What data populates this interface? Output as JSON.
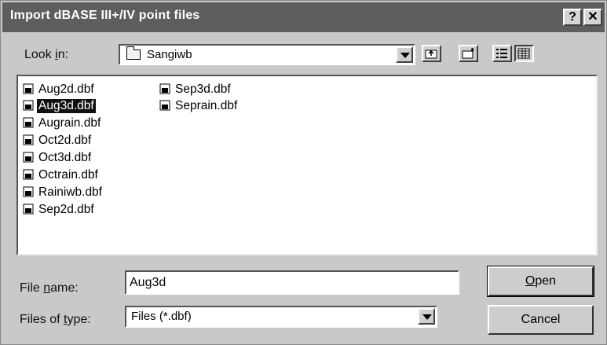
{
  "dialog": {
    "title": "Import dBASE III+/IV point files",
    "title_buttons": {
      "help": "?",
      "close": "✕"
    }
  },
  "look_in": {
    "label_prefix": "Look ",
    "label_mnemonic": "i",
    "label_suffix": "n:",
    "value": "Sangiwb",
    "folder_icon": "folder-icon"
  },
  "toolbar": {
    "up_icon": "up-one-level-icon",
    "new_folder_icon": "new-folder-icon",
    "list_icon": "list-view-icon",
    "details_icon": "details-view-icon"
  },
  "files": {
    "column1": [
      {
        "name": "Aug2d.dbf",
        "selected": false
      },
      {
        "name": "Aug3d.dbf",
        "selected": true
      },
      {
        "name": "Augrain.dbf",
        "selected": false
      },
      {
        "name": "Oct2d.dbf",
        "selected": false
      },
      {
        "name": "Oct3d.dbf",
        "selected": false
      },
      {
        "name": "Octrain.dbf",
        "selected": false
      },
      {
        "name": "Rainiwb.dbf",
        "selected": false
      },
      {
        "name": "Sep2d.dbf",
        "selected": false
      }
    ],
    "column2": [
      {
        "name": "Sep3d.dbf",
        "selected": false
      },
      {
        "name": "Seprain.dbf",
        "selected": false
      }
    ],
    "file_icon": "dbf-file-icon"
  },
  "file_name": {
    "label_prefix": "File ",
    "label_mnemonic": "n",
    "label_suffix": "ame:",
    "value": "Aug3d"
  },
  "files_of_type": {
    "label_prefix": "Files of ",
    "label_mnemonic": "t",
    "label_suffix": "ype:",
    "value": "Files (*.dbf)"
  },
  "buttons": {
    "open_mnemonic": "O",
    "open_rest": "pen",
    "cancel": "Cancel"
  },
  "colors": {
    "titlebar": "#5e5e5e",
    "face": "#c9c9c9",
    "selection": "#101010"
  }
}
